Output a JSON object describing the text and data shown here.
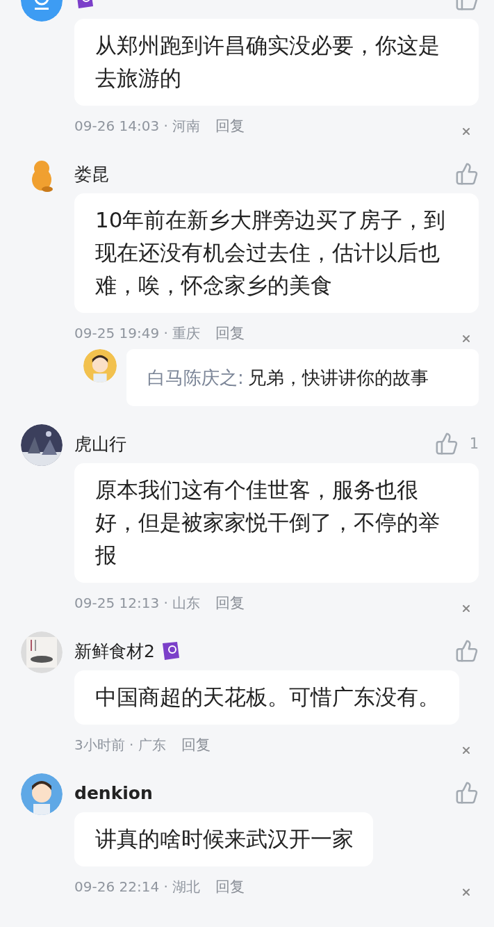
{
  "comments": [
    {
      "badge": true,
      "text": "从郑州跑到许昌确实没必要，你这是去旅游的",
      "time": "09-26 14:03 · 河南",
      "reply_label": "回复"
    },
    {
      "name": "娄昆",
      "badge": false,
      "text": "10年前在新乡大胖旁边买了房子，到现在还没有机会过去住，估计以后也难，唉，怀念家乡的美食",
      "time": "09-25 19:49 · 重庆",
      "reply_label": "回复",
      "replies": [
        {
          "name": "白马陈庆之:",
          "text": "兄弟，快讲讲你的故事"
        }
      ]
    },
    {
      "name": "虎山行",
      "badge": false,
      "likes": "1",
      "text": "原本我们这有个佳世客，服务也很好，但是被家家悦干倒了，不停的举报",
      "time": "09-25 12:13 · 山东",
      "reply_label": "回复"
    },
    {
      "name": "新鲜食材2",
      "badge": true,
      "text": "中国商超的天花板。可惜广东没有。",
      "time": "3小时前 · 广东",
      "reply_label": "回复"
    },
    {
      "name": "denkion",
      "badge": false,
      "text": "讲真的啥时候来武汉开一家",
      "time": "09-26 22:14 · 湖北",
      "reply_label": "回复"
    }
  ]
}
